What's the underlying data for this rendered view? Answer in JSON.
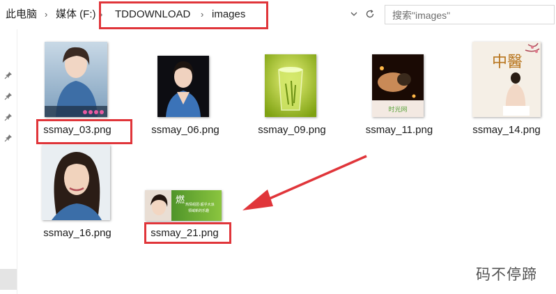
{
  "breadcrumb": {
    "items": [
      "此电脑",
      "媒体 (F:)",
      "TDDOWNLOAD",
      "images"
    ]
  },
  "search": {
    "placeholder": "搜索\"images\""
  },
  "icons": {
    "dropdown": "chevron-down-icon",
    "refresh": "refresh-icon",
    "pin": "pin-icon"
  },
  "files": [
    {
      "name": "ssmay_03.png",
      "highlighted": true
    },
    {
      "name": "ssmay_06.png",
      "highlighted": false
    },
    {
      "name": "ssmay_09.png",
      "highlighted": false
    },
    {
      "name": "ssmay_11.png",
      "highlighted": false
    },
    {
      "name": "ssmay_14.png",
      "highlighted": false
    },
    {
      "name": "ssmay_16.png",
      "highlighted": false
    },
    {
      "name": "ssmay_21.png",
      "highlighted": true
    }
  ],
  "thumb_text": {
    "t11_logo": "时光网",
    "t14_title": "中醫",
    "t21_main": "燃",
    "t21_sub1": "热情组团·超乎大派",
    "t21_sub2": "领域新的乐趣"
  },
  "watermark": "码不停蹄",
  "colors": {
    "highlight": "#e0353a",
    "arrow": "#e0353a"
  }
}
